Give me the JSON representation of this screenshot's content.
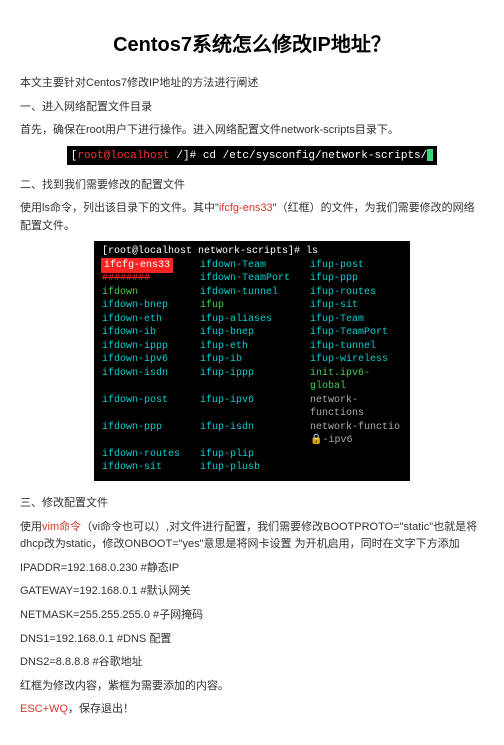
{
  "title": "Centos7系统怎么修改IP地址？",
  "intro": "本文主要针对Centos7修改IP地址的方法进行阐述",
  "section1": {
    "heading": "一、进入网络配置文件目录",
    "text": "首先，确保在root用户下进行操作。进入网络配置文件network-scripts目录下。",
    "term": {
      "user": "root@localhost ",
      "tilde": "/",
      "hash": "]# ",
      "cmd": "cd /etc/sysconfig/network-scripts/"
    }
  },
  "section2": {
    "heading": "二、找到我们需要修改的配置文件",
    "text_a": "使用ls命令，列出该目录下的文件。其中\"",
    "ifcfg": "ifcfg-ens33",
    "text_b": "\"（红框）的文件，为我们需要修改的网络配置文件。",
    "ls_prompt": "[root@localhost network-scripts]# ",
    "ls_cmd": "ls",
    "rows": [
      [
        "ifcfg-ens33",
        "ifdown-Team",
        "ifup-post",
        "",
        "",
        ""
      ],
      [
        "########",
        "ifdown-TeamPort",
        "ifup-ppp",
        "",
        "",
        ""
      ],
      [
        "ifdown",
        "ifdown-tunnel",
        "ifup-routes",
        "",
        "",
        ""
      ],
      [
        "ifdown-bnep",
        "ifup",
        "ifup-sit",
        "",
        "",
        ""
      ],
      [
        "ifdown-eth",
        "ifup-aliases",
        "ifup-Team",
        "",
        "",
        ""
      ],
      [
        "ifdown-ib",
        "ifup-bnep",
        "ifup-TeamPort",
        "",
        "",
        ""
      ],
      [
        "ifdown-ippp",
        "ifup-eth",
        "ifup-tunnel",
        "",
        "",
        ""
      ],
      [
        "ifdown-ipv6",
        "ifup-ib",
        "ifup-wireless",
        "",
        "",
        ""
      ],
      [
        "ifdown-isdn",
        "ifup-ippp",
        "init.ipv6-global",
        "",
        "",
        ""
      ],
      [
        "ifdown-post",
        "ifup-ipv6",
        "network-functions",
        "",
        "",
        ""
      ],
      [
        "ifdown-ppp",
        "ifup-isdn",
        "network-functio🔒-ipv6",
        "",
        "",
        ""
      ],
      [
        "ifdown-routes",
        "ifup-plip",
        "",
        "",
        "",
        ""
      ],
      [
        "ifdown-sit",
        "ifup-plusb",
        "",
        "",
        "",
        ""
      ]
    ]
  },
  "section3": {
    "heading": "三、修改配置文件",
    "line1_a": "使用",
    "line1_vim": "vim命令",
    "line1_b": "（vi命令也可以）,对文件进行配置，我们需要修改BOOTPROTO=\"static\"也就是将dhcp改为static，修改ONBOOT=\"yes\"意思是将网卡设置 为开机启用，同时在文字下方添加",
    "ip": "IPADDR=192.168.0.230 #静态IP",
    "gw": "GATEWAY=192.168.0.1 #默认网关",
    "mask": "NETMASK=255.255.255.0 #子网掩码",
    "dns1": "DNS1=192.168.0.1 #DNS 配置",
    "dns2": "DNS2=8.8.8.8      #谷歌地址",
    "note": "红框为修改内容，紫框为需要添加的内容。",
    "esc_a": "ESC",
    "esc_b": "+WQ",
    "esc_c": "，保存退出！"
  }
}
